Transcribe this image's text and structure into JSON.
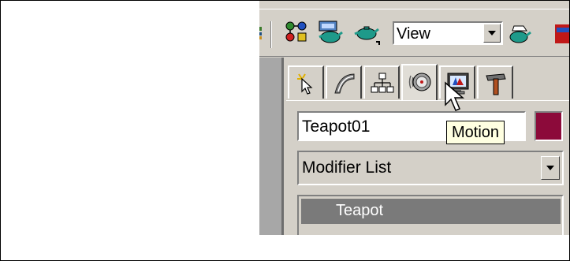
{
  "toolbar": {
    "view_dropdown": {
      "value": "View"
    },
    "icons": [
      "schematic-view-icon",
      "material-editor-icon",
      "render-scene-icon",
      "quick-render-icon",
      "render-setup-icon"
    ]
  },
  "command_panel": {
    "tabs": [
      {
        "id": "create",
        "icon": "create-tab-icon"
      },
      {
        "id": "modify",
        "icon": "modify-tab-icon"
      },
      {
        "id": "hierarchy",
        "icon": "hierarchy-tab-icon"
      },
      {
        "id": "motion",
        "icon": "motion-tab-icon",
        "active": true
      },
      {
        "id": "display",
        "icon": "display-tab-icon"
      },
      {
        "id": "utilities",
        "icon": "utilities-tab-icon"
      }
    ],
    "object_name": "Teapot01",
    "object_color": "#8c0a3a",
    "tooltip": "Motion",
    "modifier_list": {
      "value": "Modifier List"
    },
    "stack": {
      "items": [
        "Teapot"
      ]
    }
  }
}
